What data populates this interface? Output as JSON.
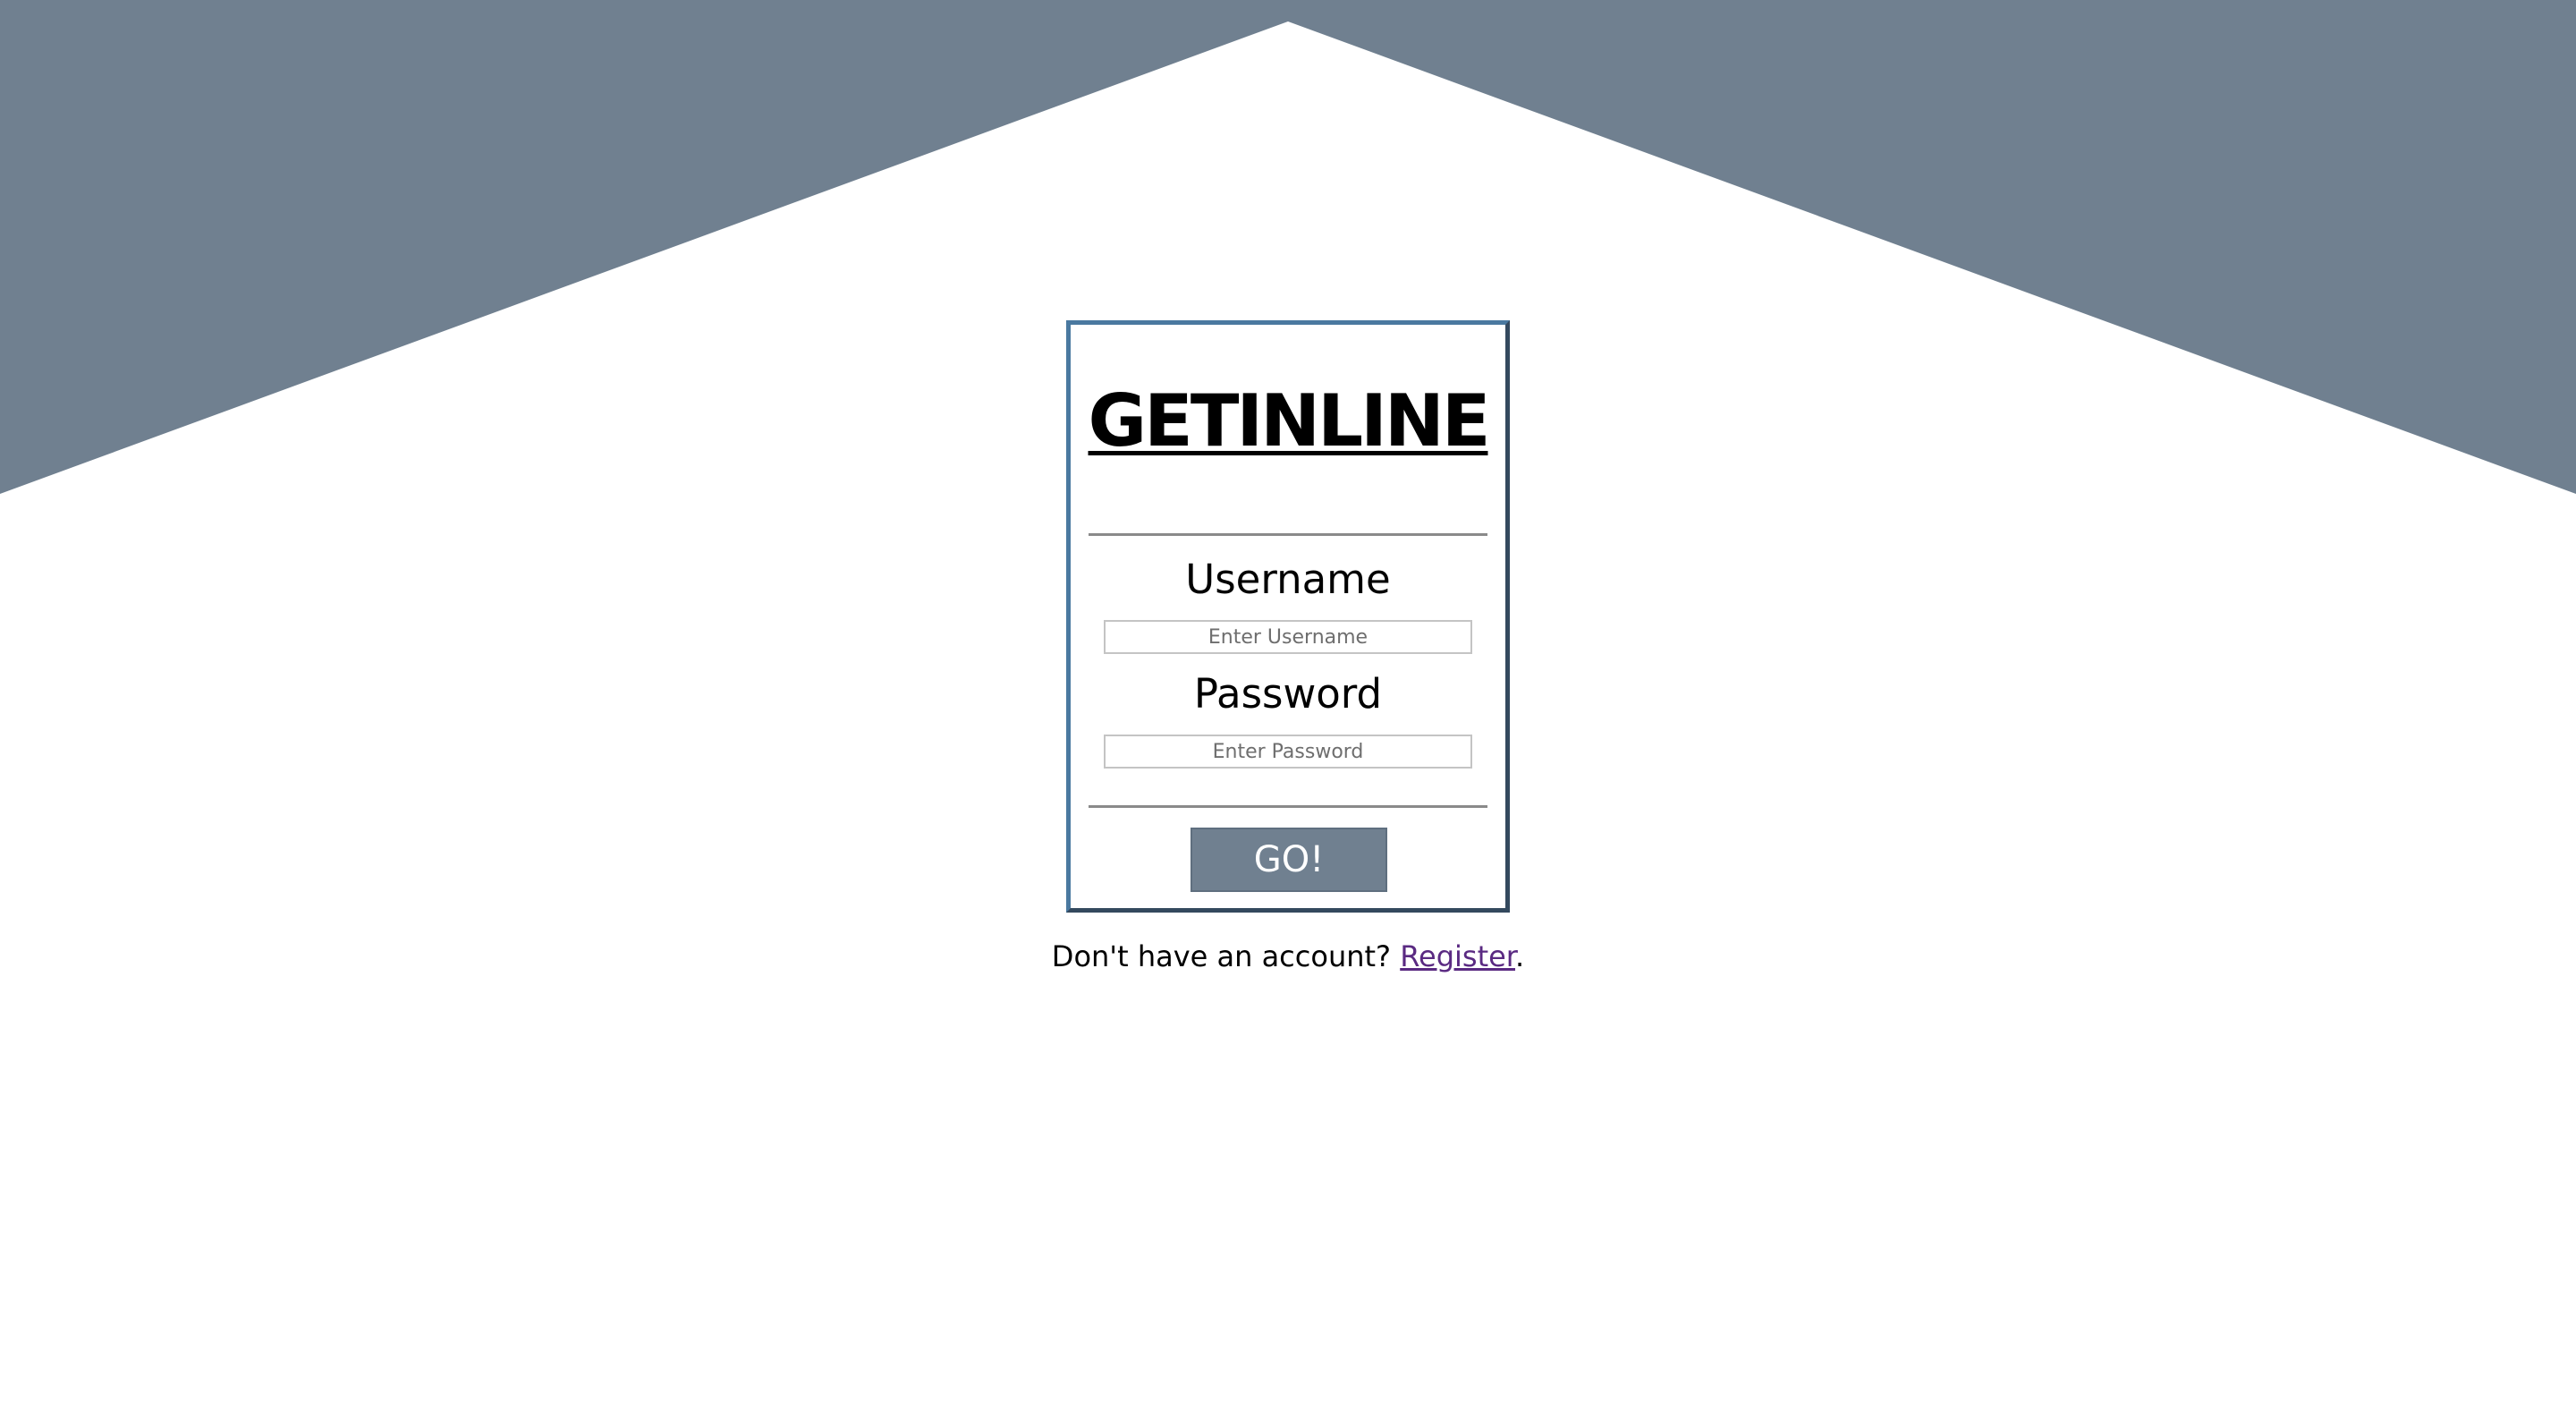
{
  "colors": {
    "background_shape": "#708090",
    "card_border": "#34495e",
    "button_bg": "#708090",
    "link": "#5a2a82"
  },
  "login_card": {
    "logo_text": "GETINLINE",
    "username_label": "Username",
    "username_placeholder": "Enter Username",
    "username_value": "",
    "password_label": "Password",
    "password_placeholder": "Enter Password",
    "password_value": "",
    "submit_label": "GO!"
  },
  "register_prompt": {
    "text": "Don't have an account? ",
    "link_label": "Register",
    "suffix": "."
  }
}
